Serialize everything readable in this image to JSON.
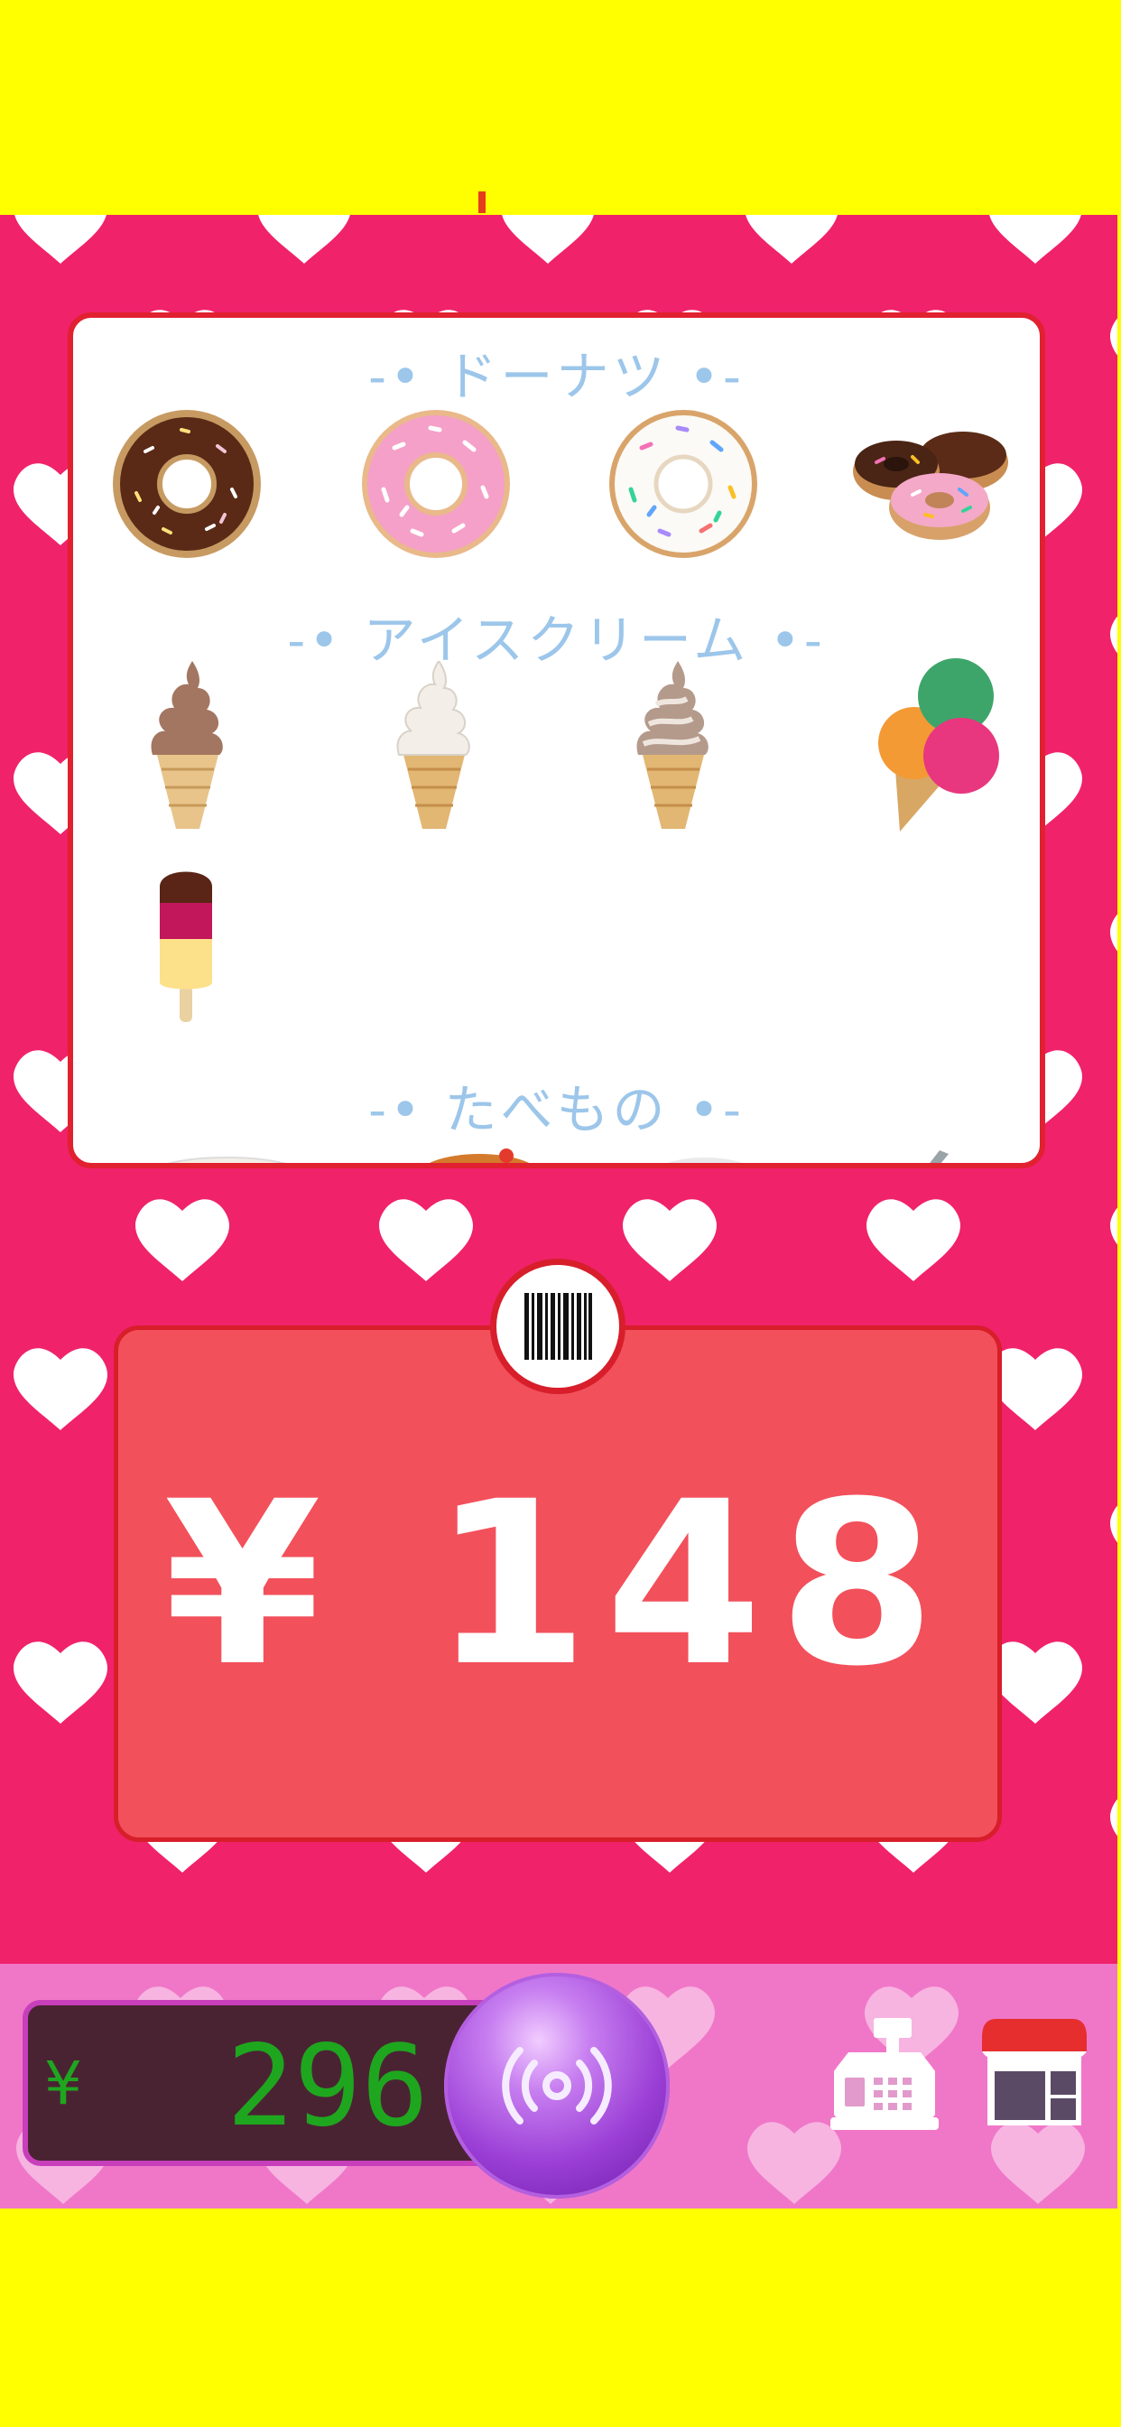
{
  "colors": {
    "page_frame": "#ffff00",
    "app_background": "#f0226a",
    "bottom_bar": "#f077c8",
    "panel_border": "#e12030",
    "price_panel": "#f2505b",
    "balance_text": "#1fa61f",
    "section_title": "#9cc6ea"
  },
  "catalog": {
    "sections": [
      {
        "title": "-• ドーナツ •-",
        "items": [
          "chocolate-donut",
          "pink-sprinkle-donut",
          "white-sprinkle-donut",
          "donut-stack"
        ]
      },
      {
        "title": "-• アイスクリーム •-",
        "items": [
          "chocolate-soft-serve",
          "vanilla-soft-serve",
          "swirl-soft-serve",
          "triple-scoop-cone",
          "popsicle"
        ]
      },
      {
        "title": "-• たべもの •-",
        "items": []
      }
    ]
  },
  "price": {
    "display": "¥ 148"
  },
  "barcode_icon": "barcode-icon",
  "balance": {
    "currency": "¥",
    "amount": "296"
  },
  "scan_button_icon": "scan-wave-icon",
  "bottom_icons": [
    "cash-register-icon",
    "shop-icon"
  ]
}
